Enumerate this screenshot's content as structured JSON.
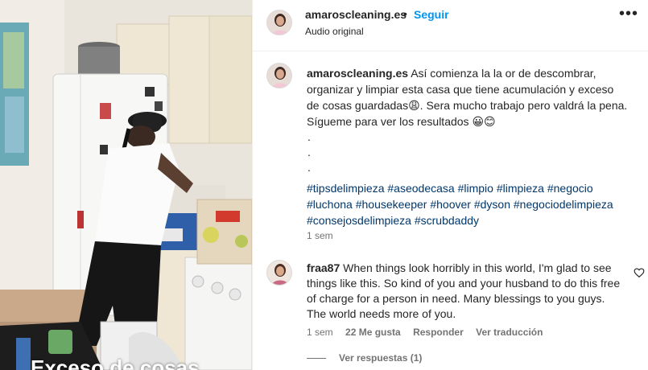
{
  "post": {
    "username": "amaroscleaning.es",
    "dot": "•",
    "follow_label": "Seguir",
    "audio_label": "Audio original",
    "more_icon": "ellipsis-icon",
    "overlay_text": "Exceso de cosas"
  },
  "caption": {
    "username": "amaroscleaning.es",
    "text": "Así comienza la la or de descombrar, organizar y limpiar esta casa que tiene acumulación y exceso de cosas guardadas😩. Sera mucho trabajo pero valdrá la pena. Sígueme para ver los resultados 😀😊",
    "dots": [
      ".",
      ".",
      "."
    ],
    "hashtags": [
      "#tipsdelimpieza",
      "#aseodecasa",
      "#limpio",
      "#limpieza",
      "#negocio",
      "#luchona",
      "#housekeeper",
      "#hoover",
      "#dyson",
      "#negociodelimpieza",
      "#consejosdelimpieza",
      "#scrubdaddy"
    ],
    "time": "1 sem"
  },
  "comment": {
    "username": "fraa87",
    "text": "When things look horribly in this world, I'm glad to see things like this. So kind of you and your husband to do this free of charge for a person in need. Many blessings to you guys. The world needs more of you.",
    "time": "1 sem",
    "likes": "22 Me gusta",
    "reply_label": "Responder",
    "translate_label": "Ver traducción",
    "view_replies": "Ver respuestas (1)"
  },
  "colors": {
    "link_blue": "#0095f6",
    "hashtag": "#00376b",
    "secondary_text": "#737373",
    "border": "#efefef"
  }
}
